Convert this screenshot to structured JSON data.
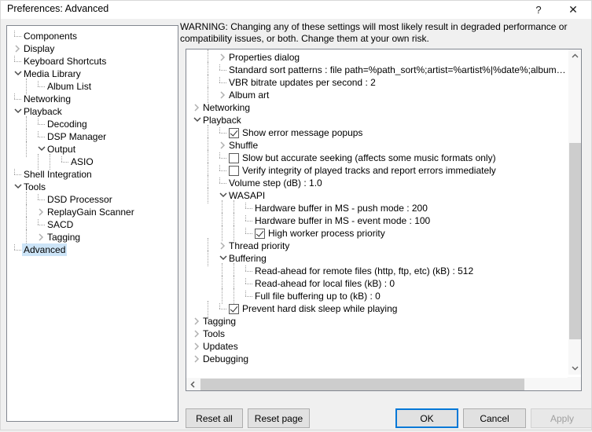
{
  "window": {
    "title": "Preferences: Advanced",
    "help_glyph": "?",
    "close_glyph": "✕"
  },
  "sidebar": {
    "items": [
      {
        "label": "Components",
        "indent": 0,
        "marker": "leaf",
        "selected": false
      },
      {
        "label": "Display",
        "indent": 0,
        "marker": "collapsed",
        "selected": false
      },
      {
        "label": "Keyboard Shortcuts",
        "indent": 0,
        "marker": "leaf",
        "selected": false
      },
      {
        "label": "Media Library",
        "indent": 0,
        "marker": "expanded",
        "selected": false
      },
      {
        "label": "Album List",
        "indent": 1,
        "marker": "leaf",
        "selected": false
      },
      {
        "label": "Networking",
        "indent": 0,
        "marker": "leaf",
        "selected": false
      },
      {
        "label": "Playback",
        "indent": 0,
        "marker": "expanded",
        "selected": false
      },
      {
        "label": "Decoding",
        "indent": 1,
        "marker": "leaf",
        "selected": false
      },
      {
        "label": "DSP Manager",
        "indent": 1,
        "marker": "leaf",
        "selected": false
      },
      {
        "label": "Output",
        "indent": 1,
        "marker": "expanded",
        "selected": false
      },
      {
        "label": "ASIO",
        "indent": 2,
        "marker": "leaf",
        "selected": false
      },
      {
        "label": "Shell Integration",
        "indent": 0,
        "marker": "leaf",
        "selected": false
      },
      {
        "label": "Tools",
        "indent": 0,
        "marker": "expanded",
        "selected": false
      },
      {
        "label": "DSD Processor",
        "indent": 1,
        "marker": "leaf",
        "selected": false
      },
      {
        "label": "ReplayGain Scanner",
        "indent": 1,
        "marker": "collapsed",
        "selected": false
      },
      {
        "label": "SACD",
        "indent": 1,
        "marker": "leaf",
        "selected": false
      },
      {
        "label": "Tagging",
        "indent": 1,
        "marker": "collapsed",
        "selected": false
      },
      {
        "label": "Advanced",
        "indent": 0,
        "marker": "leaf",
        "selected": true
      }
    ]
  },
  "main": {
    "warning": "WARNING: Changing any of these settings will most likely result in degraded performance or compatibility issues, or both. Change them at your own risk.",
    "tree": [
      {
        "label": "Properties dialog",
        "indent": 1,
        "marker": "collapsed",
        "checkbox": "none"
      },
      {
        "label": "Standard sort patterns : file path=%path_sort%;artist=%artist%|%date%;album…",
        "indent": 1,
        "marker": "leaf",
        "checkbox": "none"
      },
      {
        "label": "VBR bitrate updates per second : 2",
        "indent": 1,
        "marker": "leaf",
        "checkbox": "none"
      },
      {
        "label": "Album art",
        "indent": 1,
        "marker": "collapsed",
        "checkbox": "none"
      },
      {
        "label": "Networking",
        "indent": 0,
        "marker": "collapsed",
        "checkbox": "none"
      },
      {
        "label": "Playback",
        "indent": 0,
        "marker": "expanded",
        "checkbox": "none"
      },
      {
        "label": "Show error message popups",
        "indent": 1,
        "marker": "leaf",
        "checkbox": "checked"
      },
      {
        "label": "Shuffle",
        "indent": 1,
        "marker": "collapsed",
        "checkbox": "none"
      },
      {
        "label": "Slow but accurate seeking (affects some music formats only)",
        "indent": 1,
        "marker": "leaf",
        "checkbox": "unchecked"
      },
      {
        "label": "Verify integrity of played tracks and report errors immediately",
        "indent": 1,
        "marker": "leaf",
        "checkbox": "unchecked"
      },
      {
        "label": "Volume step (dB) : 1.0",
        "indent": 1,
        "marker": "leaf",
        "checkbox": "none"
      },
      {
        "label": "WASAPI",
        "indent": 1,
        "marker": "expanded",
        "checkbox": "none"
      },
      {
        "label": "Hardware buffer in MS - push mode : 200",
        "indent": 2,
        "marker": "leaf",
        "checkbox": "none"
      },
      {
        "label": "Hardware buffer in MS - event mode : 100",
        "indent": 2,
        "marker": "leaf",
        "checkbox": "none"
      },
      {
        "label": "High worker process priority",
        "indent": 2,
        "marker": "leaf",
        "checkbox": "checked"
      },
      {
        "label": "Thread priority",
        "indent": 1,
        "marker": "collapsed",
        "checkbox": "none"
      },
      {
        "label": "Buffering",
        "indent": 1,
        "marker": "expanded",
        "checkbox": "none"
      },
      {
        "label": "Read-ahead for remote files (http, ftp, etc) (kB) : 512",
        "indent": 2,
        "marker": "leaf",
        "checkbox": "none"
      },
      {
        "label": "Read-ahead for local files (kB) : 0",
        "indent": 2,
        "marker": "leaf",
        "checkbox": "none"
      },
      {
        "label": "Full file buffering up to (kB) : 0",
        "indent": 2,
        "marker": "leaf",
        "checkbox": "none"
      },
      {
        "label": "Prevent hard disk sleep while playing",
        "indent": 1,
        "marker": "leaf",
        "checkbox": "checked"
      },
      {
        "label": "Tagging",
        "indent": 0,
        "marker": "collapsed",
        "checkbox": "none"
      },
      {
        "label": "Tools",
        "indent": 0,
        "marker": "collapsed",
        "checkbox": "none"
      },
      {
        "label": "Updates",
        "indent": 0,
        "marker": "collapsed",
        "checkbox": "none"
      },
      {
        "label": "Debugging",
        "indent": 0,
        "marker": "collapsed",
        "checkbox": "none"
      }
    ]
  },
  "buttons": {
    "reset_all": "Reset all",
    "reset_page": "Reset page",
    "ok": "OK",
    "cancel": "Cancel",
    "apply": "Apply"
  },
  "scrollbars": {
    "v_arrow_up": "⌃",
    "v_arrow_down": "⌄",
    "h_arrow_left": "‹",
    "h_arrow_right": "›"
  },
  "colors": {
    "dialog_bg": "#f0f0f0",
    "panel_bg": "#ffffff",
    "selection": "#cce4f7",
    "focus_border": "#0078d7",
    "border": "#828790",
    "scroll_thumb": "#cdcdcd",
    "disabled_text": "#a0a0a0"
  }
}
